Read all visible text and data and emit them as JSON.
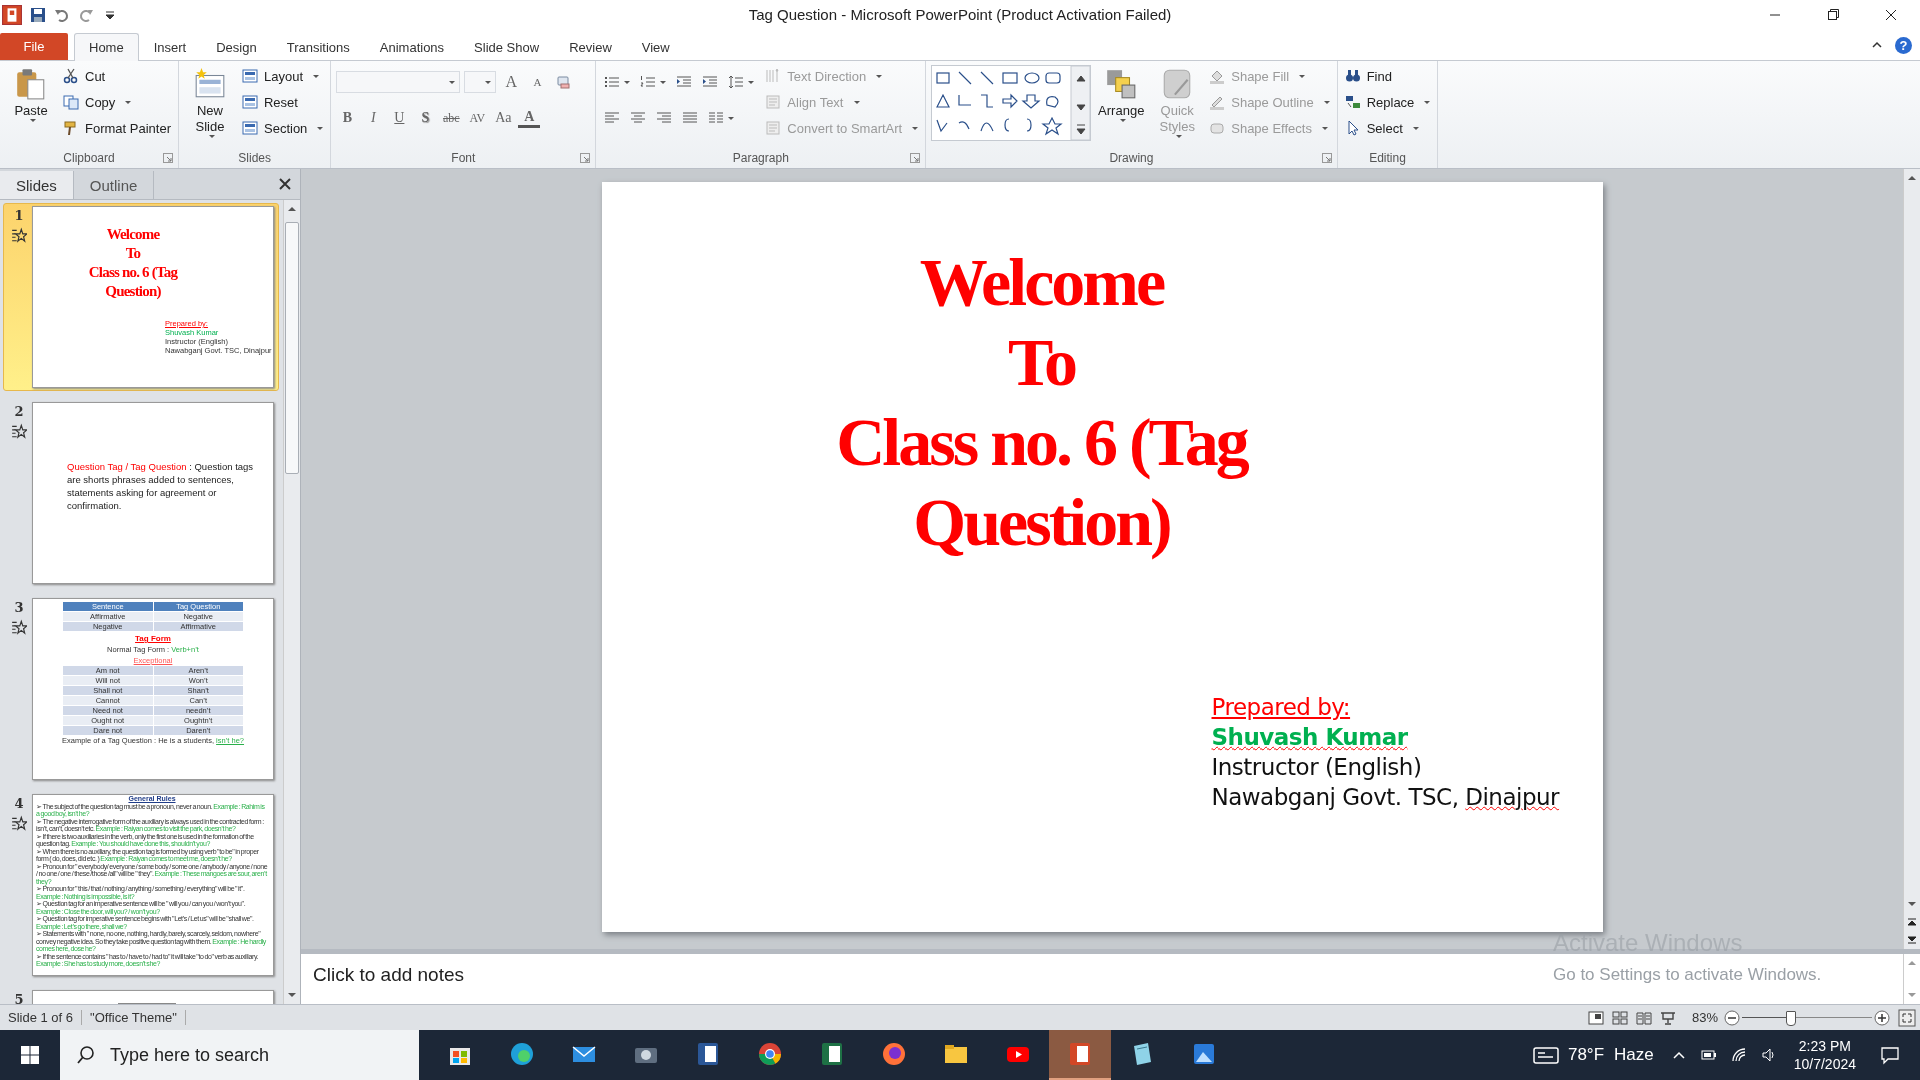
{
  "title_bar": {
    "title": "Tag Question  -  Microsoft PowerPoint (Product Activation Failed)"
  },
  "ribbon": {
    "tabs": [
      {
        "label": "File",
        "kind": "file",
        "selected": false
      },
      {
        "label": "Home",
        "kind": "tab",
        "selected": true
      },
      {
        "label": "Insert",
        "kind": "tab",
        "selected": false
      },
      {
        "label": "Design",
        "kind": "tab",
        "selected": false
      },
      {
        "label": "Transitions",
        "kind": "tab",
        "selected": false
      },
      {
        "label": "Animations",
        "kind": "tab",
        "selected": false
      },
      {
        "label": "Slide Show",
        "kind": "tab",
        "selected": false
      },
      {
        "label": "Review",
        "kind": "tab",
        "selected": false
      },
      {
        "label": "View",
        "kind": "tab",
        "selected": false
      }
    ],
    "help": "?",
    "groups": [
      {
        "name": "Clipboard",
        "launcher": true,
        "items": [
          {
            "kind": "large",
            "label": "Paste",
            "dropdown": true,
            "disabled": false
          },
          {
            "kind": "stack",
            "items": [
              {
                "label": "Cut",
                "dropdown": false,
                "disabled": false
              },
              {
                "label": "Copy",
                "dropdown": true,
                "disabled": false
              },
              {
                "label": "Format Painter",
                "dropdown": false,
                "disabled": false
              }
            ]
          }
        ]
      },
      {
        "name": "Slides",
        "launcher": false,
        "items": [
          {
            "kind": "large",
            "label": "New Slide",
            "dropdown": true,
            "disabled": false
          },
          {
            "kind": "stack",
            "items": [
              {
                "label": "Layout",
                "dropdown": true,
                "disabled": false
              },
              {
                "label": "Reset",
                "dropdown": false,
                "disabled": false
              },
              {
                "label": "Section",
                "dropdown": true,
                "disabled": false
              }
            ]
          }
        ]
      },
      {
        "name": "Font",
        "launcher": true,
        "items": [
          {
            "kind": "tools",
            "items": [
              {
                "kind": "combo"
              },
              {
                "kind": "combo"
              },
              {
                "kind": "glyph",
                "label": "A"
              },
              {
                "kind": "glyph",
                "label": "A"
              },
              {
                "kind": "icon",
                "dropdown": false
              },
              {
                "kind": "glyph",
                "label": "B"
              },
              {
                "kind": "glyph",
                "label": "I"
              },
              {
                "kind": "glyph",
                "label": "U"
              },
              {
                "kind": "glyph",
                "label": "S"
              },
              {
                "kind": "glyph",
                "label": "abc"
              },
              {
                "kind": "glyph",
                "label": "AV"
              },
              {
                "kind": "glyph",
                "label": "Aa"
              },
              {
                "kind": "glyph",
                "label": "A"
              }
            ]
          }
        ]
      },
      {
        "name": "Paragraph",
        "launcher": true,
        "items": [
          {
            "kind": "tools",
            "items": [
              {
                "kind": "icon",
                "dropdown": true
              },
              {
                "kind": "icon",
                "dropdown": true
              },
              {
                "kind": "icon",
                "dropdown": false
              },
              {
                "kind": "icon",
                "dropdown": false
              },
              {
                "kind": "icon",
                "dropdown": true
              },
              {
                "kind": "icon",
                "dropdown": false
              },
              {
                "kind": "icon",
                "dropdown": false
              },
              {
                "kind": "icon",
                "dropdown": false
              },
              {
                "kind": "icon",
                "dropdown": false
              },
              {
                "kind": "icon",
                "dropdown": true
              }
            ]
          },
          {
            "kind": "stack",
            "items": [
              {
                "label": "Text Direction",
                "dropdown": true,
                "disabled": true
              },
              {
                "label": "Align Text",
                "dropdown": true,
                "disabled": true
              },
              {
                "label": "Convert to SmartArt",
                "dropdown": true,
                "disabled": true
              }
            ]
          }
        ]
      },
      {
        "name": "Drawing",
        "launcher": true,
        "items": [
          {
            "kind": "gallery"
          },
          {
            "kind": "large",
            "label": "Arrange",
            "dropdown": true,
            "disabled": false
          },
          {
            "kind": "large",
            "label": "Quick Styles",
            "dropdown": true,
            "disabled": true
          },
          {
            "kind": "stack",
            "items": [
              {
                "label": "Shape Fill",
                "dropdown": true,
                "disabled": true
              },
              {
                "label": "Shape Outline",
                "dropdown": true,
                "disabled": true
              },
              {
                "label": "Shape Effects",
                "dropdown": true,
                "disabled": true
              }
            ]
          }
        ]
      },
      {
        "name": "Editing",
        "launcher": false,
        "items": [
          {
            "kind": "stack",
            "items": [
              {
                "label": "Find",
                "dropdown": false,
                "disabled": false
              },
              {
                "label": "Replace",
                "dropdown": true,
                "disabled": false
              },
              {
                "label": "Select",
                "dropdown": true,
                "disabled": false
              }
            ]
          }
        ]
      }
    ]
  },
  "slides_panel": {
    "tabs": [
      {
        "label": "Slides",
        "selected": true
      },
      {
        "label": "Outline",
        "selected": false
      }
    ],
    "thumbnails": [
      {
        "number": "1",
        "kind": "title",
        "selected": true,
        "animated": true,
        "title_lines": [
          "Welcome",
          "To",
          "Class no. 6 (Tag",
          "Question)"
        ],
        "credits": [
          "Prepared by:",
          "Shuvash Kumar",
          "Instructor (English)",
          "Nawabganj Govt. TSC, Dinajpur"
        ]
      },
      {
        "number": "2",
        "kind": "definition",
        "selected": false,
        "animated": true,
        "term": "Question Tag / Tag Question",
        "definition": " : Question tags are shorts phrases added to sentences, statements asking for agreement or confirmation."
      },
      {
        "number": "3",
        "kind": "tables",
        "selected": false,
        "animated": true,
        "summary_table": {
          "columns": [
            "Sentence",
            "Tag Question"
          ],
          "rows": [
            [
              "Affirmative",
              "Negative"
            ],
            [
              "Negative",
              "Affirmative"
            ]
          ]
        },
        "heading": "Tag  Form",
        "normal_label": "Normal Tag Form : ",
        "normal_value": "Verb+n’t",
        "exceptional": "Exceptional",
        "exception_rows": [
          [
            "Am not",
            "Aren’t"
          ],
          [
            "Will not",
            "Won’t"
          ],
          [
            "Shall not",
            "Shan’t"
          ],
          [
            "Cannot",
            "Can’t"
          ],
          [
            "Need not",
            "needn’t"
          ],
          [
            "Ought not",
            "Oughtn’t"
          ],
          [
            "Dare not",
            "Daren’t"
          ]
        ],
        "example_label": "Example of a  Tag Question : He is a students, ",
        "example_tag": "isn’t he?"
      },
      {
        "number": "4",
        "kind": "rules",
        "selected": false,
        "animated": true,
        "heading": "General Rules",
        "rules": [
          {
            "text": "➢ The subject of the question tag must be a pronoun, never a noun.",
            "example": "Example : Rahim is a good boy, isn’t he?"
          },
          {
            "text": "➢ The negative interrogative form of the auxiliary is always used in the contracted form : isn’t, can’t, doesn’t etc.",
            "example": "Example : Raiyan comes to visit the park, doesn’t he?"
          },
          {
            "text": "➢ If there is two auxiliaries in the verb, only the first one is used in the formation of the question tag.",
            "example": "Example : You should have done this, shouldn’t you?"
          },
          {
            "text": "➢ When there is no auxiliary, the question tag is formed by using verb \"to be\" in proper form ( do, does, did etc. )",
            "example": "Example : Raiyan comes to meet me, doesn’t he?"
          },
          {
            "text": "➢ Pronoun for \" everybody/ everyone / some body / some one / anybody / anyone / none / no one / one / these /those /all\" will be \" they\".",
            "example": "Example : These mangoes are sour, aren’t they?"
          },
          {
            "text": "➢ Pronoun for \" this / that / nothing / anything / something / everything\" will be \" it\".",
            "example": "Example : Nothing is impossible, is it?"
          },
          {
            "text": "➢ Question tag for an imperative sentence will be \" will you / can you / won’t you\".",
            "example": "Example : Close the door, will you? / won’t you?"
          },
          {
            "text": "➢ Question tag for imperative sentence begins with \"Let’s / Let us\" will be \"shall we\".",
            "example": "Example : Let’s go there, shall we?"
          },
          {
            "text": "➢ Statements with \" none, no one, nothing, hardly, barely, scarcely, seldom, nowhere\" convey negative idea. So they take positive question tag with them.",
            "example": "Example : He hardly comes here, dose he?"
          },
          {
            "text": "➢ If the sentence contains \" has to / have to / had to\" it will take \"to do\" verb as auxiliary.",
            "example": "Example : She has to study more, doesn’t she?"
          }
        ]
      },
      {
        "number": "5",
        "kind": "partial",
        "selected": false
      }
    ]
  },
  "slide": {
    "title_lines": [
      "Welcome",
      "To",
      "Class no. 6 (Tag",
      "Question)"
    ],
    "credits": [
      {
        "kind": "heading",
        "parts": [
          {
            "text": "Prepared by:",
            "misspelled": false
          }
        ]
      },
      {
        "kind": "name",
        "parts": [
          {
            "text": "Shuvash Kumar",
            "misspelled": true
          }
        ]
      },
      {
        "kind": "plain",
        "parts": [
          {
            "text": "Instructor (English)",
            "misspelled": false
          }
        ]
      },
      {
        "kind": "plain",
        "parts": [
          {
            "text": "Nawabganj Govt. TSC, ",
            "misspelled": false
          },
          {
            "text": "Dinajpur",
            "misspelled": true
          }
        ]
      }
    ]
  },
  "notes": {
    "placeholder": "Click to add notes"
  },
  "activation_notice": {
    "title": "Activate Windows",
    "subtitle": "Go to Settings to activate Windows."
  },
  "status_bar": {
    "slide_info": "Slide 1 of 6",
    "theme": "\"Office Theme\"",
    "zoom": "83%",
    "zoom_slider": {
      "level": 0.38
    }
  },
  "taskbar": {
    "search_placeholder": "Type here to search",
    "apps": [
      {
        "kind": "store",
        "selected": false
      },
      {
        "kind": "edge",
        "selected": false
      },
      {
        "kind": "mail",
        "selected": false
      },
      {
        "kind": "camera",
        "selected": false
      },
      {
        "kind": "word",
        "selected": false
      },
      {
        "kind": "chrome",
        "selected": false
      },
      {
        "kind": "excel",
        "selected": false
      },
      {
        "kind": "firefox",
        "selected": false
      },
      {
        "kind": "files",
        "selected": false
      },
      {
        "kind": "youtube",
        "selected": false
      },
      {
        "kind": "powerpoint",
        "selected": true
      },
      {
        "kind": "notepad",
        "selected": false
      },
      {
        "kind": "photos",
        "selected": false
      }
    ],
    "weather": {
      "temperature": "78°F",
      "condition": "Haze"
    },
    "time": "2:23 PM",
    "date": "10/7/2024"
  }
}
